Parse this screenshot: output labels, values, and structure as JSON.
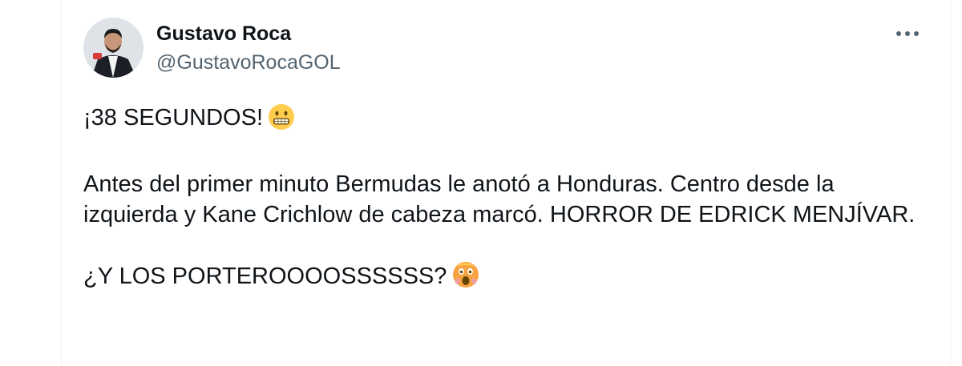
{
  "tweet": {
    "author": {
      "display_name": "Gustavo Roca",
      "handle": "@GustavoRocaGOL",
      "avatar_icon": "profile-photo"
    },
    "more_icon": "more-horizontal-icon",
    "lines": {
      "line1": "¡38 SEGUNDOS!",
      "line1_emoji": "grimacing-face",
      "para2": "Antes del primer minuto Bermudas le anotó a Honduras. Centro desde la izquierda y Kane Crichlow de cabeza marcó. HORROR DE EDRICK MENJÍVAR.",
      "line3": "¿Y LOS PORTEROOOOSSSSSS?",
      "line3_emoji": "astonished-face"
    }
  },
  "colors": {
    "text_primary": "#0f1419",
    "text_secondary": "#536471",
    "emoji_yellow": "#ffcc4d",
    "emoji_orange": "#f4a340"
  }
}
